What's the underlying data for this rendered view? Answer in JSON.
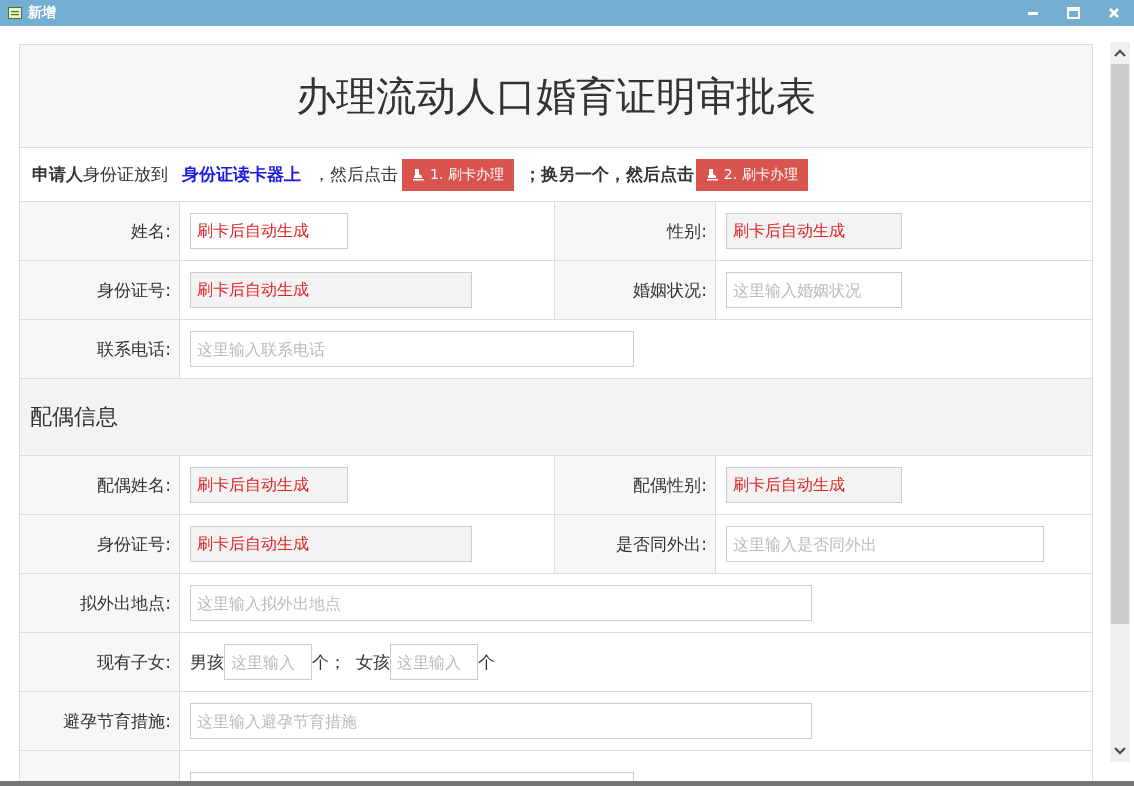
{
  "window": {
    "title": "新增"
  },
  "form": {
    "title": "办理流动人口婚育证明审批表",
    "instruction": [
      {
        "kind": "bold",
        "text": "申请人"
      },
      {
        "kind": "text",
        "text": "身份证放到"
      },
      {
        "kind": "link",
        "text": "身份证读卡器上"
      },
      {
        "kind": "text",
        "text": "，然后点击"
      },
      {
        "kind": "button",
        "text": "1. 刷卡办理"
      },
      {
        "kind": "bold",
        "text": "；换另一个，然后点击"
      },
      {
        "kind": "button",
        "text": "2. 刷卡办理"
      }
    ],
    "rows": [
      {
        "kind": "pair",
        "fields": [
          {
            "label": "姓名:",
            "value": "刷卡后自动生成",
            "readonly": false
          },
          {
            "label": "性别:",
            "value": "刷卡后自动生成",
            "readonly": true
          }
        ]
      },
      {
        "kind": "pair",
        "fields": [
          {
            "label": "身份证号:",
            "value": "刷卡后自动生成",
            "readonly": true
          },
          {
            "label": "婚姻状况:",
            "placeholder": "这里输入婚姻状况",
            "readonly": false
          }
        ]
      },
      {
        "kind": "single",
        "fields": [
          {
            "label": "联系电话:",
            "placeholder": "这里输入联系电话",
            "readonly": false
          }
        ]
      },
      {
        "kind": "section",
        "title": "配偶信息"
      },
      {
        "kind": "pair",
        "fields": [
          {
            "label": "配偶姓名:",
            "value": "刷卡后自动生成",
            "readonly": true
          },
          {
            "label": "配偶性别:",
            "value": "刷卡后自动生成",
            "readonly": true
          }
        ]
      },
      {
        "kind": "pair",
        "fields": [
          {
            "label": "身份证号:",
            "value": "刷卡后自动生成",
            "readonly": true
          },
          {
            "label": "是否同外出:",
            "placeholder": "这里输入是否同外出",
            "readonly": false
          }
        ]
      },
      {
        "kind": "single",
        "fields": [
          {
            "label": "拟外出地点:",
            "placeholder": "这里输入拟外出地点",
            "readonly": false
          }
        ]
      },
      {
        "kind": "children",
        "label": "现有子女:",
        "parts": [
          {
            "kind": "text",
            "text": "男孩"
          },
          {
            "kind": "input",
            "placeholder": "这里输入"
          },
          {
            "kind": "text",
            "text": "个；"
          },
          {
            "kind": "text",
            "text": "女孩"
          },
          {
            "kind": "input",
            "placeholder": "这里输入"
          },
          {
            "kind": "text",
            "text": "个"
          }
        ]
      },
      {
        "kind": "single",
        "fields": [
          {
            "label": "避孕节育措施:",
            "placeholder": "这里输入避孕节育措施",
            "readonly": false
          }
        ]
      },
      {
        "kind": "cut"
      }
    ]
  }
}
